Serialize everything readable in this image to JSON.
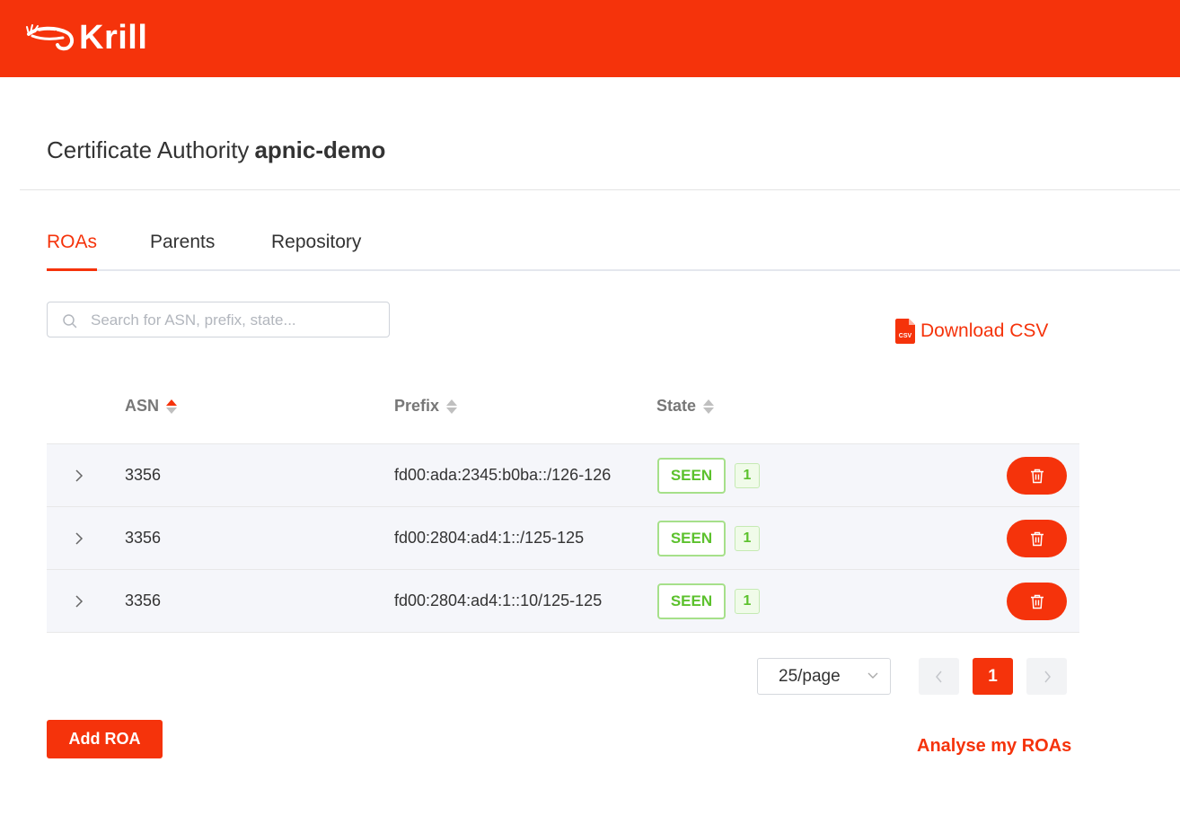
{
  "header": {
    "logo_text": "Krill",
    "logo_icon": "shrimp-icon"
  },
  "ca": {
    "label": "Certificate Authority",
    "name": "apnic-demo"
  },
  "tabs": [
    {
      "label": "ROAs",
      "active": true
    },
    {
      "label": "Parents",
      "active": false
    },
    {
      "label": "Repository",
      "active": false
    }
  ],
  "search": {
    "placeholder": "Search for ASN, prefix, state...",
    "value": ""
  },
  "download_csv": {
    "label": "Download CSV",
    "icon_text": "CSV"
  },
  "table": {
    "columns": [
      {
        "label": "ASN",
        "sort": "ascending"
      },
      {
        "label": "Prefix",
        "sort": "none"
      },
      {
        "label": "State",
        "sort": "none"
      }
    ],
    "rows": [
      {
        "asn": "3356",
        "prefix": "fd00:ada:2345:b0ba::/126-126",
        "state": "SEEN",
        "count": "1"
      },
      {
        "asn": "3356",
        "prefix": "fd00:2804:ad4:1::/125-125",
        "state": "SEEN",
        "count": "1"
      },
      {
        "asn": "3356",
        "prefix": "fd00:2804:ad4:1::10/125-125",
        "state": "SEEN",
        "count": "1"
      }
    ]
  },
  "pagination": {
    "page_size": "25/page",
    "current_page": "1"
  },
  "actions": {
    "add_roa": "Add ROA",
    "analyse": "Analyse my ROAs"
  },
  "colors": {
    "brand": "#f5330b",
    "seen_green": "#5cc12d"
  }
}
